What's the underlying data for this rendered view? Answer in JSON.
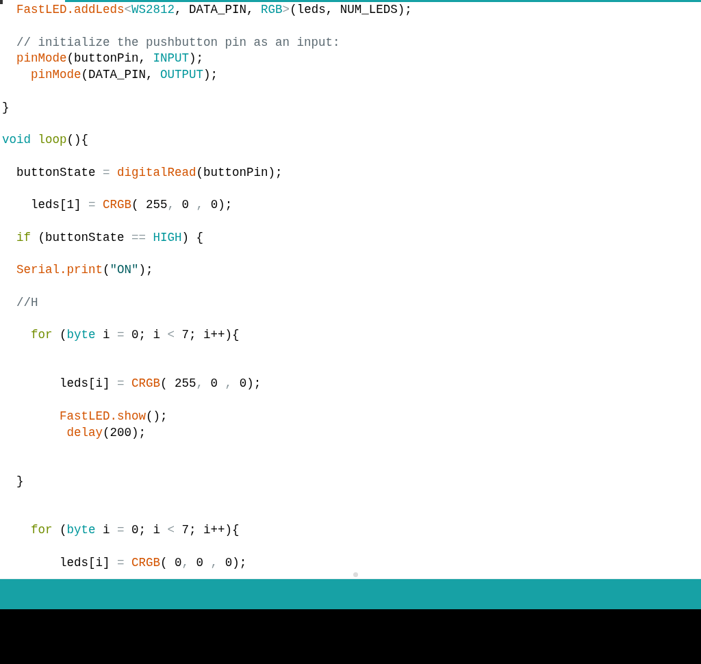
{
  "editor": {
    "lines": [
      {
        "kind": "code",
        "tokens": [
          {
            "text": "  FastLED.addLeds",
            "kind": "fn"
          },
          {
            "text": "<",
            "kind": "op"
          },
          {
            "text": "WS2812",
            "kind": "const"
          },
          {
            "text": ", DATA_PIN, "
          },
          {
            "text": "RGB",
            "kind": "const"
          },
          {
            "text": ">",
            "kind": "op"
          },
          {
            "text": "(leds, NUM_LEDS);"
          }
        ]
      },
      {
        "kind": "blank"
      },
      {
        "kind": "code",
        "tokens": [
          {
            "text": "  // initialize the pushbutton pin as an input:",
            "kind": "comment"
          }
        ]
      },
      {
        "kind": "code",
        "tokens": [
          {
            "text": "  pinMode",
            "kind": "fn"
          },
          {
            "text": "(buttonPin, "
          },
          {
            "text": "INPUT",
            "kind": "const"
          },
          {
            "text": ");"
          }
        ]
      },
      {
        "kind": "code",
        "tokens": [
          {
            "text": "    pinMode",
            "kind": "fn"
          },
          {
            "text": "(DATA_PIN, "
          },
          {
            "text": "OUTPUT",
            "kind": "const"
          },
          {
            "text": ");"
          }
        ]
      },
      {
        "kind": "blank"
      },
      {
        "kind": "code",
        "tokens": [
          {
            "text": "}"
          }
        ]
      },
      {
        "kind": "blank"
      },
      {
        "kind": "code",
        "tokens": [
          {
            "text": "void ",
            "kind": "type"
          },
          {
            "text": "loop",
            "kind": "keyword"
          },
          {
            "text": "(){"
          }
        ]
      },
      {
        "kind": "blank"
      },
      {
        "kind": "code",
        "tokens": [
          {
            "text": "  buttonState "
          },
          {
            "text": "= ",
            "kind": "op"
          },
          {
            "text": "digitalRead",
            "kind": "fn"
          },
          {
            "text": "(buttonPin);"
          }
        ]
      },
      {
        "kind": "blank"
      },
      {
        "kind": "code",
        "tokens": [
          {
            "text": "    leds[1] "
          },
          {
            "text": "= ",
            "kind": "op"
          },
          {
            "text": "CRGB",
            "kind": "fn"
          },
          {
            "text": "( 255"
          },
          {
            "text": ",",
            "kind": "op"
          },
          {
            "text": " 0 "
          },
          {
            "text": ",",
            "kind": "op"
          },
          {
            "text": " 0);"
          }
        ]
      },
      {
        "kind": "blank"
      },
      {
        "kind": "code",
        "tokens": [
          {
            "text": "  if",
            "kind": "keyword"
          },
          {
            "text": " (buttonState "
          },
          {
            "text": "== ",
            "kind": "op"
          },
          {
            "text": "HIGH",
            "kind": "const"
          },
          {
            "text": ") {"
          }
        ]
      },
      {
        "kind": "blank"
      },
      {
        "kind": "code",
        "tokens": [
          {
            "text": "  Serial.print",
            "kind": "fn"
          },
          {
            "text": "("
          },
          {
            "text": "\"ON\"",
            "kind": "string"
          },
          {
            "text": ");"
          }
        ]
      },
      {
        "kind": "blank"
      },
      {
        "kind": "code",
        "tokens": [
          {
            "text": "  //H",
            "kind": "comment"
          }
        ]
      },
      {
        "kind": "blank"
      },
      {
        "kind": "code",
        "tokens": [
          {
            "text": "    for",
            "kind": "keyword"
          },
          {
            "text": " ("
          },
          {
            "text": "byte",
            "kind": "type"
          },
          {
            "text": " i "
          },
          {
            "text": "=",
            "kind": "op"
          },
          {
            "text": " 0; i "
          },
          {
            "text": "<",
            "kind": "op"
          },
          {
            "text": " 7; i++){"
          }
        ]
      },
      {
        "kind": "blank"
      },
      {
        "kind": "blank"
      },
      {
        "kind": "code",
        "tokens": [
          {
            "text": "        leds[i] "
          },
          {
            "text": "= ",
            "kind": "op"
          },
          {
            "text": "CRGB",
            "kind": "fn"
          },
          {
            "text": "( 255"
          },
          {
            "text": ",",
            "kind": "op"
          },
          {
            "text": " 0 "
          },
          {
            "text": ",",
            "kind": "op"
          },
          {
            "text": " 0);"
          }
        ]
      },
      {
        "kind": "blank"
      },
      {
        "kind": "code",
        "tokens": [
          {
            "text": "        FastLED.show",
            "kind": "fn"
          },
          {
            "text": "();"
          }
        ]
      },
      {
        "kind": "code",
        "tokens": [
          {
            "text": "         delay",
            "kind": "fn"
          },
          {
            "text": "(200);"
          }
        ]
      },
      {
        "kind": "blank"
      },
      {
        "kind": "blank"
      },
      {
        "kind": "code",
        "tokens": [
          {
            "text": "  }"
          }
        ]
      },
      {
        "kind": "blank"
      },
      {
        "kind": "blank"
      },
      {
        "kind": "code",
        "tokens": [
          {
            "text": "    for",
            "kind": "keyword"
          },
          {
            "text": " ("
          },
          {
            "text": "byte",
            "kind": "type"
          },
          {
            "text": " i "
          },
          {
            "text": "=",
            "kind": "op"
          },
          {
            "text": " 0; i "
          },
          {
            "text": "<",
            "kind": "op"
          },
          {
            "text": " 7; i++){"
          }
        ]
      },
      {
        "kind": "blank"
      },
      {
        "kind": "code",
        "tokens": [
          {
            "text": "        leds[i] "
          },
          {
            "text": "= ",
            "kind": "op"
          },
          {
            "text": "CRGB",
            "kind": "fn"
          },
          {
            "text": "( 0"
          },
          {
            "text": ",",
            "kind": "op"
          },
          {
            "text": " 0 "
          },
          {
            "text": ",",
            "kind": "op"
          },
          {
            "text": " 0);"
          }
        ]
      }
    ]
  }
}
